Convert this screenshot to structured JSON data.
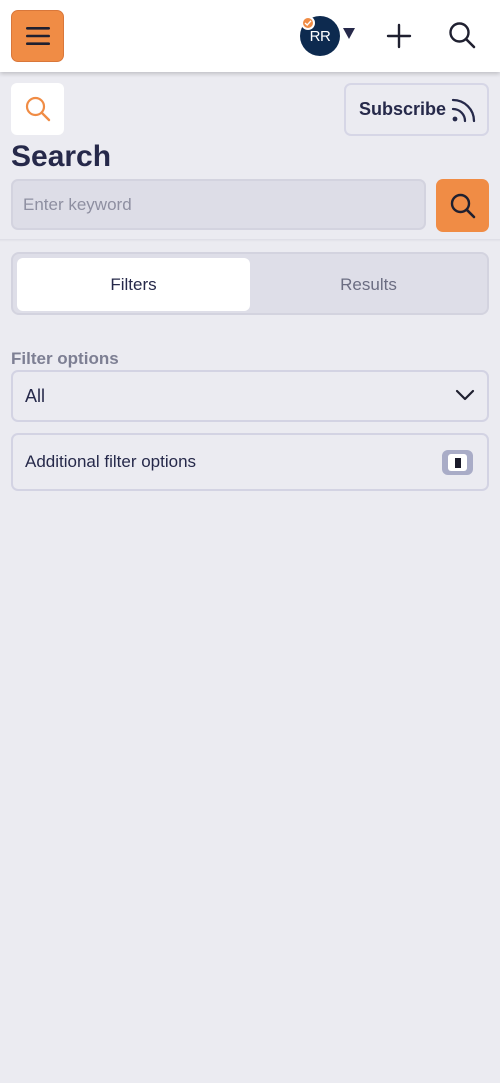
{
  "topbar": {
    "menu_icon": "hamburger-icon",
    "avatar_initials": "RR",
    "avatar_badge_icon": "check-badge-icon",
    "account_caret_icon": "caret-down-icon",
    "add_icon": "plus-icon",
    "search_icon": "search-icon"
  },
  "header": {
    "subscribe_label": "Subscribe",
    "subscribe_icon": "rss-icon",
    "title": "Search",
    "keyword_placeholder": "Enter keyword",
    "keyword_value": ""
  },
  "tabs": [
    {
      "label": "Filters",
      "active": true
    },
    {
      "label": "Results",
      "active": false
    }
  ],
  "filters": {
    "label": "Filter options",
    "selected": "All",
    "additional_label": "Additional filter options",
    "additional_enabled": false
  },
  "colors": {
    "accent": "#f08c45",
    "background": "#ebebf1",
    "text": "#26294a",
    "avatar_bg": "#0d2a4f"
  }
}
